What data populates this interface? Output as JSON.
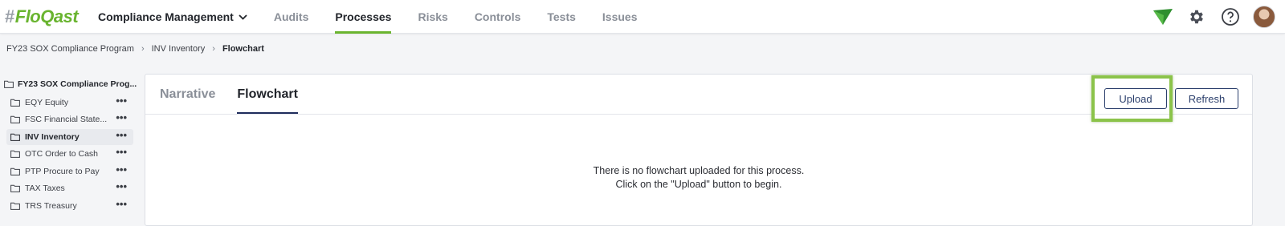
{
  "header": {
    "logo_hash": "#",
    "logo_text": "FloQast",
    "nav": [
      {
        "label": "Compliance Management"
      },
      {
        "label": "Audits"
      },
      {
        "label": "Processes"
      },
      {
        "label": "Risks"
      },
      {
        "label": "Controls"
      },
      {
        "label": "Tests"
      },
      {
        "label": "Issues"
      }
    ],
    "active_nav": "Processes"
  },
  "breadcrumb": {
    "items": [
      "FY23 SOX Compliance Program",
      "INV Inventory"
    ],
    "current": "Flowchart",
    "separator": "›"
  },
  "sidebar": {
    "root": "FY23 SOX Compliance Prog...",
    "items": [
      {
        "label": "EQY Equity"
      },
      {
        "label": "FSC Financial State..."
      },
      {
        "label": "INV Inventory"
      },
      {
        "label": "OTC Order to Cash"
      },
      {
        "label": "PTP Procure to Pay"
      },
      {
        "label": "TAX Taxes"
      },
      {
        "label": "TRS Treasury"
      }
    ],
    "selected": "INV Inventory",
    "more_glyph": "•••"
  },
  "panel": {
    "tabs": [
      {
        "label": "Narrative"
      },
      {
        "label": "Flowchart"
      }
    ],
    "active_tab": "Flowchart",
    "upload_label": "Upload",
    "refresh_label": "Refresh",
    "empty_line1": "There is no flowchart uploaded for this process.",
    "empty_line2": "Click on the \"Upload\" button to begin."
  },
  "icons": [
    "chevron-down-icon",
    "floqast-check-icon",
    "gear-icon",
    "help-icon",
    "avatar",
    "folder-icon",
    "more-icon"
  ],
  "colors": {
    "brand_green": "#6ab42f",
    "highlight_green": "#8bc34a",
    "active_tab_underline": "#1f2d5c",
    "button_navy": "#2b3f6c"
  }
}
